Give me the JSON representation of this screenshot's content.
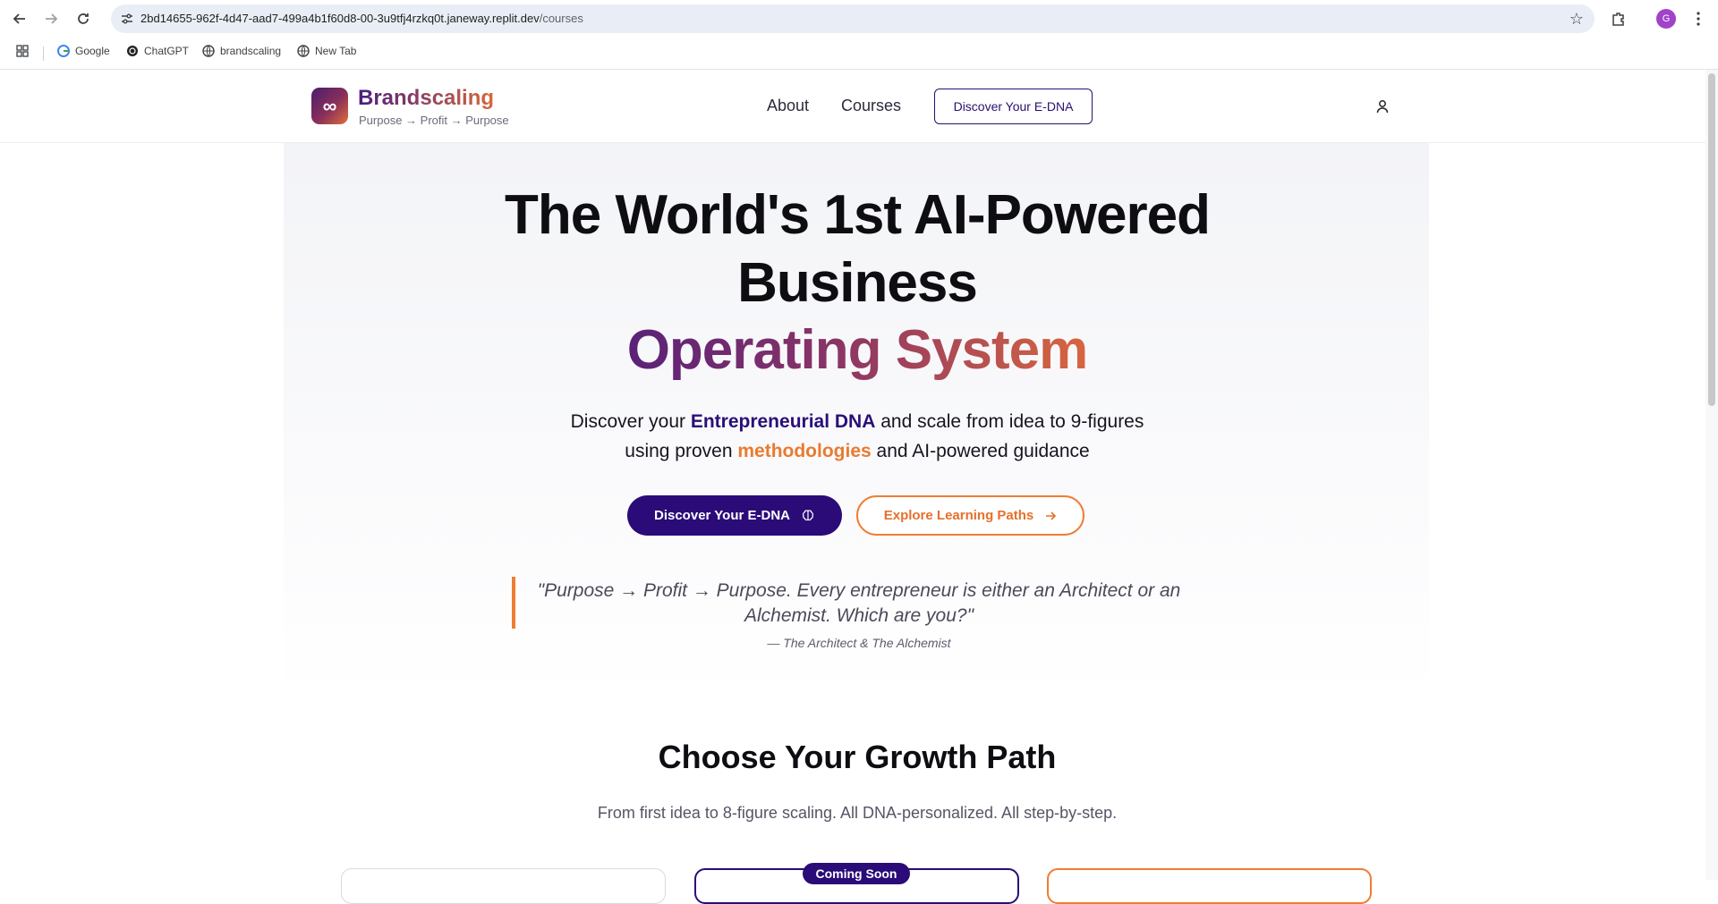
{
  "browser": {
    "url_host": "2bd14655-962f-4d47-aad7-499a4b1f60d8-00-3u9tfj4rzkq0t.janeway.replit.dev",
    "url_path": "/courses",
    "profile_initial": "G",
    "bookmarks": [
      "Google",
      "ChatGPT",
      "brandscaling",
      "New Tab"
    ]
  },
  "header": {
    "logo_symbol": "∞",
    "brand_name": "Brandscaling",
    "tagline": "Purpose → Profit → Purpose",
    "nav": {
      "about": "About",
      "courses": "Courses",
      "cta": "Discover Your E-DNA"
    }
  },
  "hero": {
    "title_line1": "The World's 1st AI-Powered",
    "title_line2": "Business",
    "title_line3": "Operating System",
    "sub_line1_pre": "Discover your ",
    "sub_line1_hl": "Entrepreneurial DNA",
    "sub_line1_post": " and scale from idea to 9-figures",
    "sub_line2_pre": "using proven ",
    "sub_line2_hl": "methodologies",
    "sub_line2_post": " and AI-powered guidance",
    "primary_button": "Discover Your E-DNA",
    "secondary_button": "Explore Learning Paths",
    "quote": "\"Purpose → Profit → Purpose. Every entrepreneur is either an Architect or an Alchemist. Which are you?\"",
    "quote_attribution": "— The Architect & The Alchemist"
  },
  "growth": {
    "title": "Choose Your Growth Path",
    "subtitle": "From first idea to 8-figure scaling. All DNA-personalized. All step-by-step.",
    "badge": "Coming Soon"
  },
  "colors": {
    "brand_purple": "#2a0b78",
    "brand_orange": "#ef7d33"
  }
}
